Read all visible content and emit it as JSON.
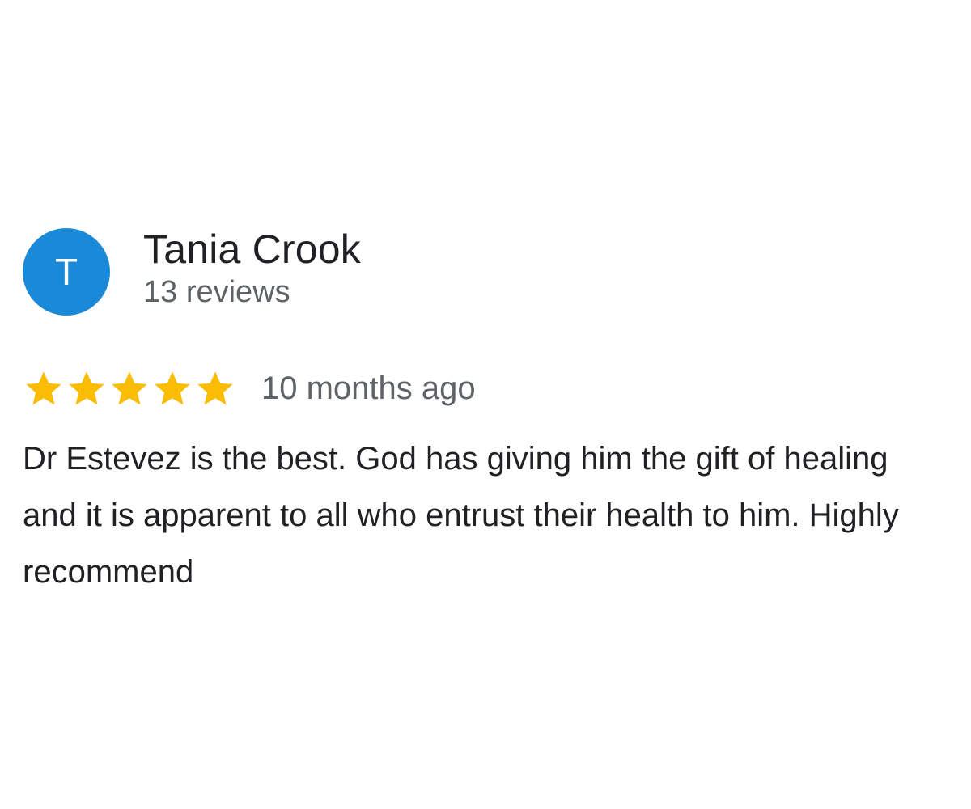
{
  "review": {
    "author": {
      "initial": "T",
      "name": "Tania Crook",
      "reviews_count": "13 reviews",
      "avatar_color": "#1a8ad8"
    },
    "rating": 5,
    "rating_max": 5,
    "star_color": "#fbbc04",
    "time": "10 months ago",
    "text": "Dr Estevez is the best. God has giving him the gift of healing and it is apparent to all who entrust their health to him. Highly recommend"
  }
}
